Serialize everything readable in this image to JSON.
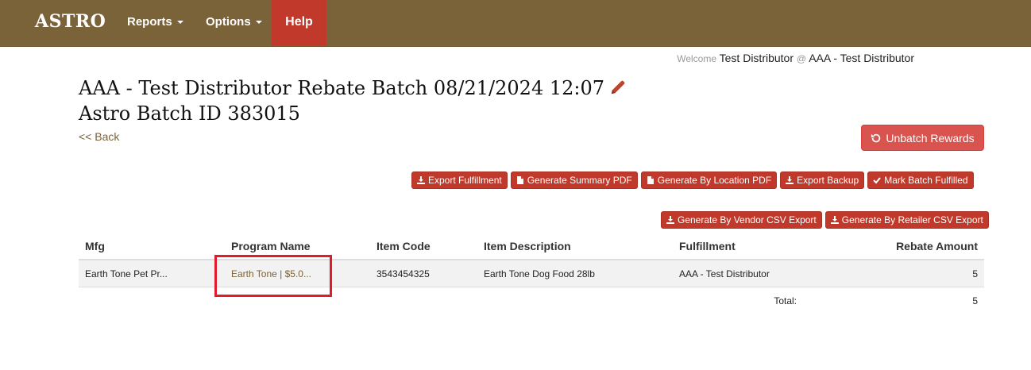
{
  "navbar": {
    "brand": "ASTRO",
    "reports": "Reports",
    "options": "Options",
    "help": "Help"
  },
  "welcome": {
    "prefix": "Welcome",
    "user": "Test Distributor",
    "at": "@",
    "org": "AAA - Test Distributor"
  },
  "page": {
    "title_line1": "AAA - Test Distributor Rebate Batch 08/21/2024 12:07",
    "title_line2": "Astro Batch ID 383015",
    "back": "<< Back"
  },
  "buttons": {
    "unbatch": "Unbatch Rewards",
    "export_fulfillment": "Export Fulfillment",
    "summary_pdf": "Generate Summary PDF",
    "location_pdf": "Generate By Location PDF",
    "export_backup": "Export Backup",
    "mark_fulfilled": "Mark Batch Fulfilled",
    "vendor_csv": "Generate By Vendor CSV Export",
    "retailer_csv": "Generate By Retailer CSV Export"
  },
  "table": {
    "headers": [
      "Mfg",
      "Program Name",
      "Item Code",
      "Item Description",
      "Fulfillment",
      "Rebate Amount"
    ],
    "rows": [
      {
        "mfg": "Earth Tone Pet Pr...",
        "program": "Earth Tone | $5.0...",
        "item_code": "3543454325",
        "description": "Earth Tone Dog Food 28lb",
        "fulfillment": "AAA - Test Distributor",
        "amount": "5"
      }
    ],
    "total_label": "Total:",
    "total_value": "5"
  },
  "colors": {
    "navbar": "#7a6239",
    "help_bg": "#c0392b",
    "button_danger": "#d9534f",
    "button_small": "#c0392b",
    "highlight": "#e21b2c"
  }
}
